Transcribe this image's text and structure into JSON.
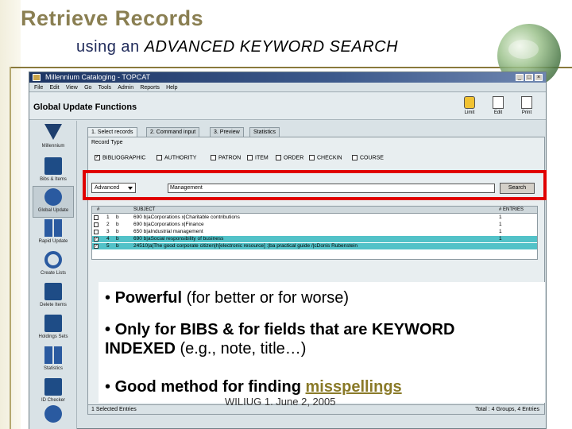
{
  "slide": {
    "title": "Retrieve Records",
    "subtitle_prefix": "using an",
    "subtitle_emph": "ADVANCED KEYWORD SEARCH",
    "footer": "WILIUG 1. June 2, 2005"
  },
  "window": {
    "title": "Millennium Cataloging - TOPCAT",
    "menu": [
      "File",
      "Edit",
      "View",
      "Go",
      "Tools",
      "Admin",
      "Reports",
      "Help"
    ],
    "header_title": "Global Update Functions",
    "toolbar": [
      {
        "label": "Limit",
        "icon": "hand-icon"
      },
      {
        "label": "Edit",
        "icon": "edit-icon"
      },
      {
        "label": "Print",
        "icon": "print-icon"
      }
    ]
  },
  "sidebar": {
    "items": [
      {
        "label": "Millennium",
        "icon": "millennium-logo-icon"
      },
      {
        "label": "Bibs & Items",
        "icon": "document-icon"
      },
      {
        "label": "Global Update",
        "icon": "global-update-icon",
        "active": true
      },
      {
        "label": "Rapid Update",
        "icon": "rapid-update-icon"
      },
      {
        "label": "Create Lists",
        "icon": "create-lists-icon"
      },
      {
        "label": "Delete Items",
        "icon": "delete-items-icon"
      },
      {
        "label": "Holdings Sets",
        "icon": "holdings-icon"
      },
      {
        "label": "Statistics",
        "icon": "statistics-icon"
      },
      {
        "label": "ID Checker",
        "icon": "checker-icon"
      },
      {
        "label": "",
        "icon": "more-icon"
      }
    ]
  },
  "tabs": [
    "1. Select records",
    "2. Command input",
    "3. Preview",
    "Statistics"
  ],
  "record_type": {
    "label": "Record Type",
    "options": [
      {
        "label": "BIBLIOGRAPHIC",
        "checked": true
      },
      {
        "label": "AUTHORITY",
        "checked": false
      },
      {
        "label": "PATRON",
        "checked": false
      },
      {
        "label": "ITEM",
        "checked": false
      },
      {
        "label": "ORDER",
        "checked": false
      },
      {
        "label": "CHECKIN",
        "checked": false
      },
      {
        "label": "COURSE",
        "checked": false
      }
    ]
  },
  "search": {
    "type": "Advanced",
    "value": "Management",
    "button": "Search"
  },
  "results": {
    "columns": [
      "#",
      "SUBJECT",
      "# ENTRIES"
    ],
    "rows": [
      {
        "n": "1",
        "code": "b",
        "subject": "690 b|aCorporations x|Charitable contributions",
        "entries": "1",
        "checked": false,
        "selected": false
      },
      {
        "n": "2",
        "code": "b",
        "subject": "690 b|aCorporations x|Finance",
        "entries": "1",
        "checked": false,
        "selected": false
      },
      {
        "n": "3",
        "code": "b",
        "subject": "650 b|aIndustrial management",
        "entries": "1",
        "checked": false,
        "selected": false
      },
      {
        "n": "4",
        "code": "b",
        "subject": "690 b|aSocial responsibility of business",
        "entries": "1",
        "checked": true,
        "selected": true
      },
      {
        "n": "5",
        "code": "b",
        "subject": "24510|a|The good corporate citizen|h[electronic resource] :|ba practical guide /|cDonis Rubenstein",
        "entries": "",
        "checked": true,
        "selected": true
      }
    ]
  },
  "status": {
    "left": "1 Selected Entries",
    "right": "Total : 4 Groups, 4 Entries"
  },
  "bullets": {
    "b1_bold": "Powerful",
    "b1_rest": " (for better or for worse)",
    "b2_line1": "Only for BIBS & for fields that are KEYWORD",
    "b2_line2_bold": "INDEXED",
    "b2_line2_rest": " (e.g., note, title…)",
    "b3_bold": "Good method for finding ",
    "b3_link": "misspellings"
  },
  "colors": {
    "highlight": "#e00000",
    "title": "#8a7f52",
    "selected_row": "#52c2c8"
  }
}
